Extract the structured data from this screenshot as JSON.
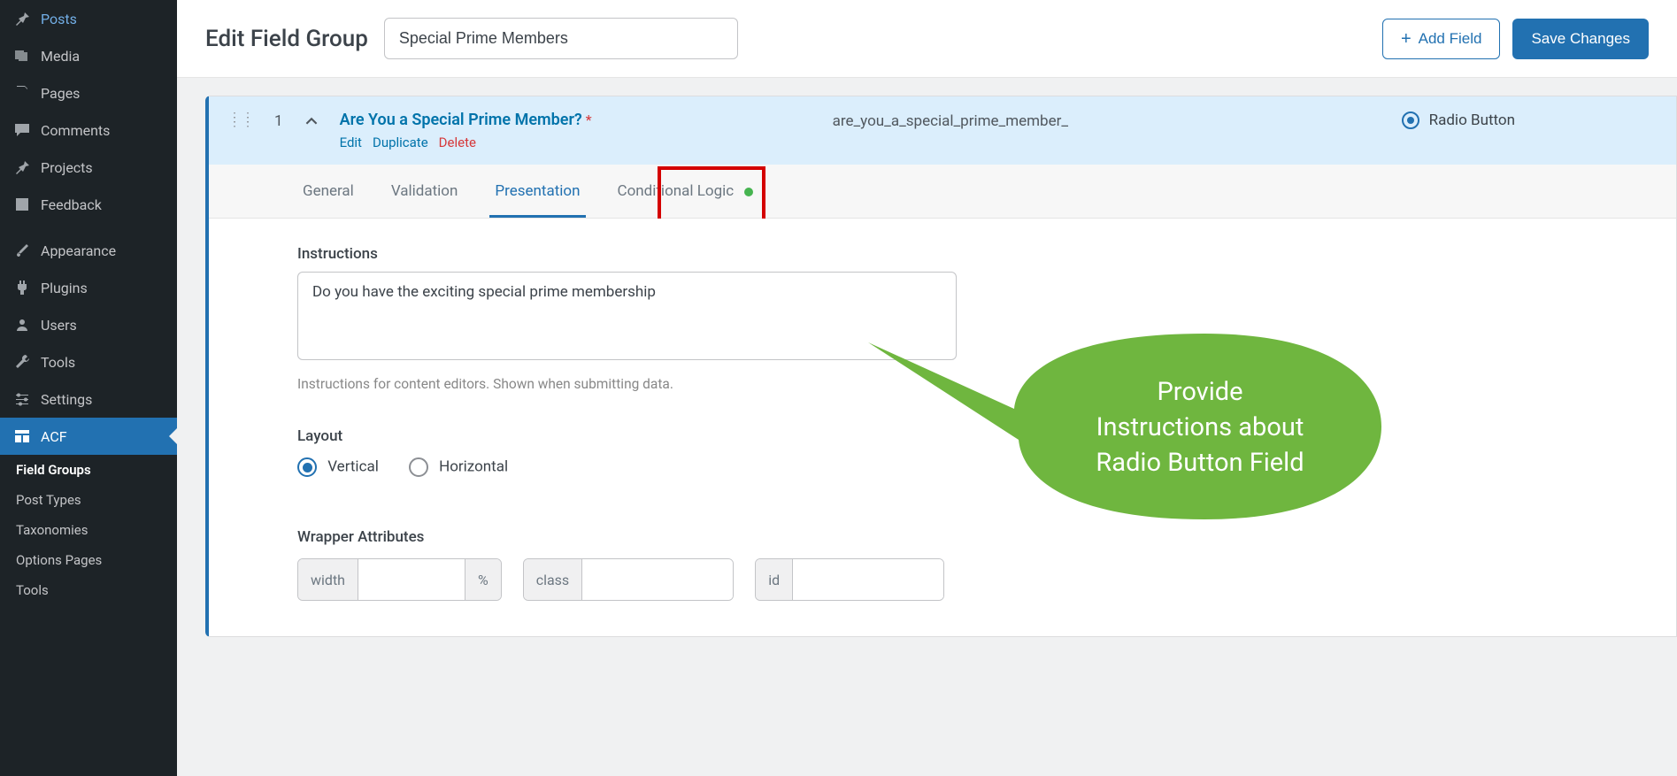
{
  "sidebar": {
    "items": [
      {
        "label": "Posts"
      },
      {
        "label": "Media"
      },
      {
        "label": "Pages"
      },
      {
        "label": "Comments"
      },
      {
        "label": "Projects"
      },
      {
        "label": "Feedback"
      },
      {
        "label": "Appearance"
      },
      {
        "label": "Plugins"
      },
      {
        "label": "Users"
      },
      {
        "label": "Tools"
      },
      {
        "label": "Settings"
      },
      {
        "label": "ACF"
      }
    ],
    "sub": [
      {
        "label": "Field Groups",
        "current": true
      },
      {
        "label": "Post Types"
      },
      {
        "label": "Taxonomies"
      },
      {
        "label": "Options Pages"
      },
      {
        "label": "Tools"
      }
    ]
  },
  "header": {
    "page_title": "Edit Field Group",
    "group_name": "Special Prime Members",
    "add_field": "Add Field",
    "save": "Save Changes"
  },
  "field": {
    "num": "1",
    "title": "Are You a Special Prime Member?",
    "slug": "are_you_a_special_prime_member_",
    "type": "Radio Button",
    "actions": {
      "edit": "Edit",
      "duplicate": "Duplicate",
      "del": "Delete"
    }
  },
  "tabs": {
    "general": "General",
    "validation": "Validation",
    "presentation": "Presentation",
    "conditional": "Conditional Logic"
  },
  "panel": {
    "instructions_label": "Instructions",
    "instructions_value": "Do you have the exciting special prime membership",
    "instructions_help": "Instructions for content editors. Shown when submitting data.",
    "layout_label": "Layout",
    "layout_vertical": "Vertical",
    "layout_horizontal": "Horizontal",
    "wrapper_label": "Wrapper Attributes",
    "wrap_width": "width",
    "wrap_pct": "%",
    "wrap_class": "class",
    "wrap_id": "id"
  },
  "callout": {
    "line1": "Provide",
    "line2": "Instructions about",
    "line3": "Radio Button Field"
  }
}
